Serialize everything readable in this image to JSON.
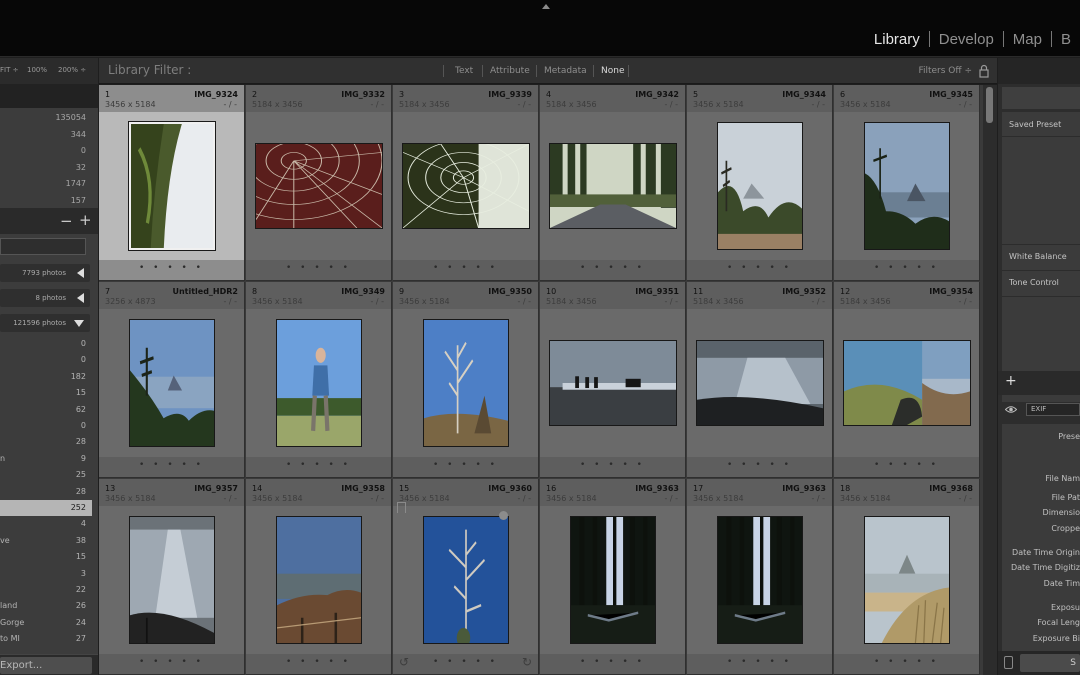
{
  "modules": [
    "Library",
    "Develop",
    "Map",
    "B"
  ],
  "active_module": "Library",
  "navigator": {
    "zoom_options": [
      "FIT ÷",
      "100%",
      "200% ÷"
    ]
  },
  "catalog_counts": [
    "135054",
    "344",
    "0",
    "32",
    "1747",
    "157"
  ],
  "collections": {
    "sets": [
      {
        "count": "7793 photos",
        "state": "collapsed"
      },
      {
        "count": "8 photos",
        "state": "collapsed"
      },
      {
        "count": "121596 photos",
        "state": "expanded"
      }
    ],
    "rows": [
      {
        "label": "",
        "count": "0"
      },
      {
        "label": "",
        "count": "0"
      },
      {
        "label": "",
        "count": "182"
      },
      {
        "label": "",
        "count": "15"
      },
      {
        "label": "",
        "count": "62"
      },
      {
        "label": "",
        "count": "0"
      },
      {
        "label": "",
        "count": "28"
      },
      {
        "label": "n",
        "count": "9"
      },
      {
        "label": "",
        "count": "25"
      },
      {
        "label": "",
        "count": "28"
      },
      {
        "label": "",
        "count": "252",
        "selected": true
      },
      {
        "label": "",
        "count": "4"
      },
      {
        "label": "ve",
        "count": "38"
      },
      {
        "label": "",
        "count": "15"
      },
      {
        "label": "",
        "count": "3"
      },
      {
        "label": "",
        "count": "22"
      },
      {
        "label": "land",
        "count": "26"
      },
      {
        "label": "Gorge",
        "count": "24"
      },
      {
        "label": "to MI",
        "count": "27"
      }
    ]
  },
  "export_label": "Export...",
  "filter_bar": {
    "title": "Library Filter :",
    "tabs": [
      "Text",
      "Attribute",
      "Metadata",
      "None"
    ],
    "active_tab": "None",
    "filters_off": "Filters Off ÷"
  },
  "grid": {
    "rating_dots": "• • • • •",
    "cells": [
      {
        "index": "1",
        "name": "IMG_9324",
        "dims": "3456 x 5184",
        "rating": "- / -",
        "selected": true,
        "orientation": "portrait",
        "scene": "mossy"
      },
      {
        "index": "2",
        "name": "IMG_9332",
        "dims": "5184 x 3456",
        "rating": "- / -",
        "orientation": "landscape",
        "scene": "web-red"
      },
      {
        "index": "3",
        "name": "IMG_9339",
        "dims": "5184 x 3456",
        "rating": "- / -",
        "orientation": "landscape",
        "scene": "web-green"
      },
      {
        "index": "4",
        "name": "IMG_9342",
        "dims": "5184 x 3456",
        "rating": "- / -",
        "orientation": "landscape",
        "scene": "road"
      },
      {
        "index": "5",
        "name": "IMG_9344",
        "dims": "3456 x 5184",
        "rating": "- / -",
        "orientation": "portrait",
        "scene": "coast-hazy"
      },
      {
        "index": "6",
        "name": "IMG_9345",
        "dims": "3456 x 5184",
        "rating": "- / -",
        "orientation": "portrait",
        "scene": "coast-blue"
      },
      {
        "index": "7",
        "name": "Untitled_HDR2",
        "dims": "3256 x 4873",
        "rating": "- / -",
        "orientation": "portrait",
        "scene": "coast-trees"
      },
      {
        "index": "8",
        "name": "IMG_9349",
        "dims": "3456 x 5184",
        "rating": "- / -",
        "orientation": "portrait",
        "scene": "person"
      },
      {
        "index": "9",
        "name": "IMG_9350",
        "dims": "3456 x 5184",
        "rating": "- / -",
        "orientation": "portrait",
        "scene": "dead-tree"
      },
      {
        "index": "10",
        "name": "IMG_9351",
        "dims": "5184 x 3456",
        "rating": "- / -",
        "orientation": "landscape",
        "scene": "silhouette"
      },
      {
        "index": "11",
        "name": "IMG_9352",
        "dims": "5184 x 3456",
        "rating": "- / -",
        "orientation": "landscape",
        "scene": "sea-glare"
      },
      {
        "index": "12",
        "name": "IMG_9354",
        "dims": "5184 x 3456",
        "rating": "- / -",
        "orientation": "landscape",
        "scene": "painting"
      },
      {
        "index": "13",
        "name": "IMG_9357",
        "dims": "3456 x 5184",
        "rating": "- / -",
        "orientation": "portrait",
        "scene": "sea-silver"
      },
      {
        "index": "14",
        "name": "IMG_9358",
        "dims": "3456 x 5184",
        "rating": "- / -",
        "orientation": "portrait",
        "scene": "cliff-fence"
      },
      {
        "index": "15",
        "name": "IMG_9360",
        "dims": "3456 x 5184",
        "rating": "- / -",
        "orientation": "portrait",
        "scene": "snag-sky",
        "badges": true
      },
      {
        "index": "16",
        "name": "IMG_9363",
        "dims": "3456 x 5184",
        "rating": "- / -",
        "orientation": "portrait",
        "scene": "forest-dark"
      },
      {
        "index": "17",
        "name": "IMG_9363",
        "dims": "3456 x 5184",
        "rating": "- / -",
        "orientation": "portrait",
        "scene": "forest-dark"
      },
      {
        "index": "18",
        "name": "IMG_9368",
        "dims": "3456 x 5184",
        "rating": "- / -",
        "orientation": "portrait",
        "scene": "beach-grass"
      }
    ]
  },
  "quick_develop": {
    "saved_preset": "Saved Preset",
    "white_balance": "White Balance",
    "tone_control": "Tone Control"
  },
  "keywording_plus": "+",
  "metadata": {
    "preset": "EXIF",
    "preset_button": "Prese",
    "fields": [
      "File Nam",
      "File Pat",
      "Dimensio",
      "Croppe",
      "Date Time Origin",
      "Date Time Digitiz",
      "Date Tim",
      "Exposu",
      "Focal Leng",
      "Exposure Bi"
    ]
  },
  "sync_label": "S"
}
